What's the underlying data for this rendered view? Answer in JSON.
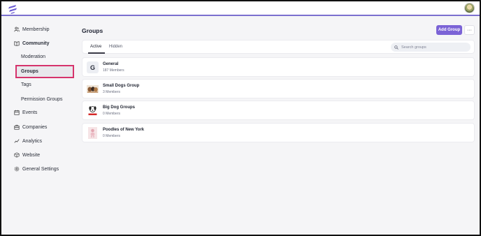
{
  "app": {
    "accent": "#7b63d6",
    "highlight_color": "#d6336c"
  },
  "topbar": {
    "logo": "brand-logo-icon",
    "avatar": "user-avatar"
  },
  "sidebar": {
    "items": [
      {
        "label": "Membership",
        "icon": "users-icon"
      },
      {
        "label": "Community",
        "icon": "book-icon"
      },
      {
        "label": "Moderation"
      },
      {
        "label": "Groups"
      },
      {
        "label": "Tags"
      },
      {
        "label": "Permission Groups"
      },
      {
        "label": "Events",
        "icon": "calendar-icon"
      },
      {
        "label": "Companies",
        "icon": "briefcase-icon"
      },
      {
        "label": "Analytics",
        "icon": "chart-icon"
      },
      {
        "label": "Website",
        "icon": "globe-icon"
      },
      {
        "label": "General Settings",
        "icon": "gear-icon"
      }
    ]
  },
  "main": {
    "title": "Groups",
    "add_button": "Add Group",
    "more_button": "···",
    "tabs": [
      {
        "label": "Active"
      },
      {
        "label": "Hidden"
      }
    ],
    "search": {
      "placeholder": "Search groups"
    },
    "groups": [
      {
        "name": "General",
        "members": "187 Members",
        "thumb_letter": "G"
      },
      {
        "name": "Small Dogs Group",
        "members": "3 Members"
      },
      {
        "name": "Big Dog Groups",
        "members": "0 Members"
      },
      {
        "name": "Poodles of New York",
        "members": "0 Members"
      }
    ]
  }
}
